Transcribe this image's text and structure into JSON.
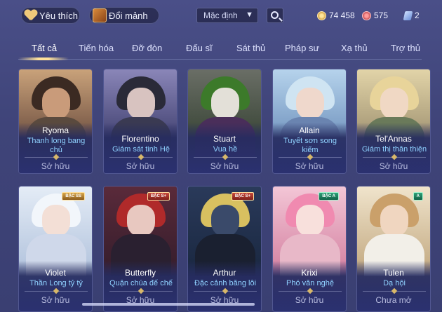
{
  "topbar": {
    "favorites_label": "Yêu thích",
    "fragments_label": "Đổi mảnh",
    "sort_value": "Mặc định",
    "currencies": [
      {
        "icon": "gold-coin-icon",
        "value": "74 458"
      },
      {
        "icon": "gem-icon",
        "value": "575"
      },
      {
        "icon": "ticket-icon",
        "value": "2"
      }
    ]
  },
  "tabs": [
    {
      "label": "Tất cả",
      "active": true
    },
    {
      "label": "Tiến hóa"
    },
    {
      "label": "Đỡ đòn"
    },
    {
      "label": "Đấu sĩ"
    },
    {
      "label": "Sát thủ"
    },
    {
      "label": "Pháp sư"
    },
    {
      "label": "Xạ thủ"
    },
    {
      "label": "Trợ thủ"
    }
  ],
  "cards": [
    {
      "name": "Ryoma",
      "skin": "Thanh long bang chủ",
      "status": "Sở hữu",
      "badge": ""
    },
    {
      "name": "Florentino",
      "skin": "Giám sát tinh Hệ",
      "status": "Sở hữu",
      "badge": ""
    },
    {
      "name": "Stuart",
      "skin": "Vua hề",
      "status": "Sở hữu",
      "badge": ""
    },
    {
      "name": "Allain",
      "skin": "Tuyết sơn song kiếm",
      "status": "Sở hữu",
      "badge": ""
    },
    {
      "name": "Tel'Annas",
      "skin": "Giám thị thân thiện",
      "status": "Sở hữu",
      "badge": ""
    },
    {
      "name": "Violet",
      "skin": "Thần Long tỷ tỷ",
      "status": "Sở hữu",
      "badge": "BẬC SS"
    },
    {
      "name": "Butterfly",
      "skin": "Quận chúa đế chế",
      "status": "Sở hữu",
      "badge": "BẬC S+"
    },
    {
      "name": "Arthur",
      "skin": "Đặc cảnh băng lôi",
      "status": "Sở hữu",
      "badge": "BẬC S+"
    },
    {
      "name": "Krixi",
      "skin": "Phó văn nghệ",
      "status": "Sở hữu",
      "badge": "BẬC A"
    },
    {
      "name": "Tulen",
      "skin": "Dạ hội",
      "status": "Chưa mở",
      "badge": "A"
    }
  ],
  "colors": {
    "background": "#444a80",
    "skin_text": "#8fd1ff",
    "tab_indicator": "#ffe29a"
  }
}
